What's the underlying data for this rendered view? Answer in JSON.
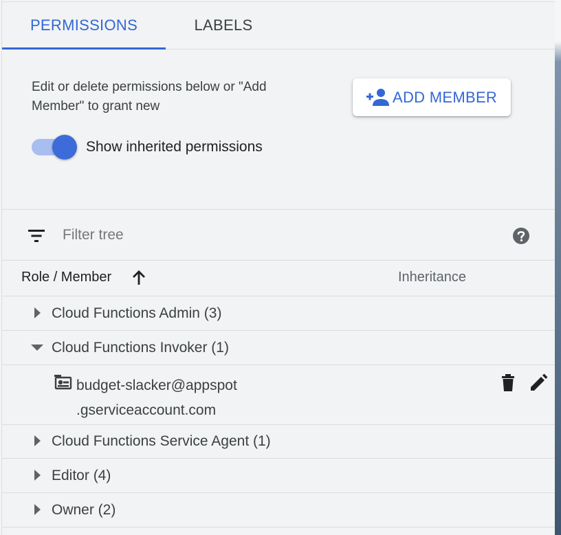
{
  "tabs": [
    {
      "label": "PERMISSIONS",
      "active": true
    },
    {
      "label": "LABELS",
      "active": false
    }
  ],
  "description": "Edit or delete permissions below or \"Add Member\" to grant new",
  "add_member_button": {
    "label": "ADD MEMBER",
    "icon": "person-add-icon"
  },
  "inherited_toggle": {
    "label": "Show inherited permissions",
    "on": true
  },
  "filter": {
    "placeholder": "Filter tree",
    "icon": "filter-icon",
    "help_icon": "help-icon"
  },
  "table_header": {
    "col1": "Role / Member",
    "col2": "Inheritance",
    "sort": "ascending"
  },
  "rows": [
    {
      "label": "Cloud Functions Admin (3)",
      "expanded": false
    },
    {
      "label": "Cloud Functions Invoker (1)",
      "expanded": true
    },
    {
      "label": "Cloud Functions Service Agent (1)",
      "expanded": false
    },
    {
      "label": "Editor (4)",
      "expanded": false
    },
    {
      "label": "Owner (2)",
      "expanded": false
    }
  ],
  "member": {
    "line1": "budget-slacker@appspot",
    "line2": ".gserviceaccount.com",
    "icon": "service-account-icon",
    "actions": [
      "delete-icon",
      "edit-icon"
    ]
  },
  "colors": {
    "accent": "#3367d6",
    "text": "#3c4043",
    "panel_bg": "#f1f3f4"
  }
}
